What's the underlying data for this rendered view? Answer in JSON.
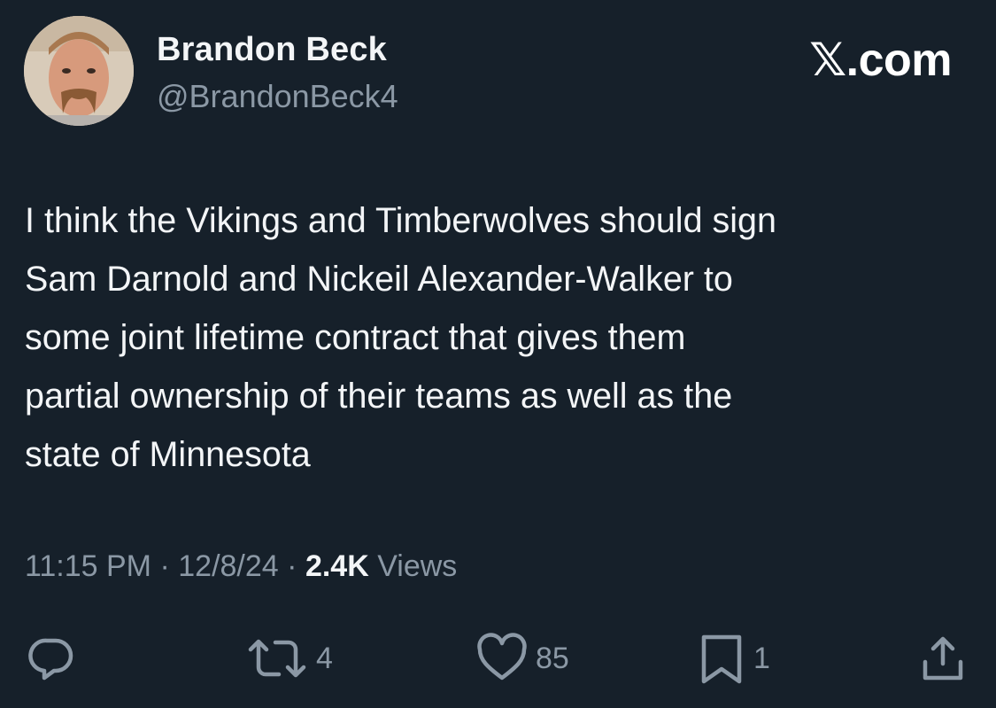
{
  "author": {
    "display_name": "Brandon Beck",
    "handle": "@BrandonBeck4"
  },
  "brand": "𝕏.com",
  "tweet": {
    "text": "I think the Vikings and Timberwolves should sign\nSam Darnold and Nickeil Alexander-Walker to\nsome joint lifetime contract that gives them\npartial ownership of their teams as well as the\nstate of Minnesota"
  },
  "meta": {
    "time": "11:15 PM",
    "separator": "·",
    "date": "12/8/24",
    "views_count": "2.4K",
    "views_label": "Views"
  },
  "actions": {
    "reply": {
      "icon": "reply-icon",
      "count": ""
    },
    "retweet": {
      "icon": "retweet-icon",
      "count": "4"
    },
    "like": {
      "icon": "heart-icon",
      "count": "85"
    },
    "bookmark": {
      "icon": "bookmark-icon",
      "count": "1"
    },
    "share": {
      "icon": "share-icon",
      "count": ""
    }
  },
  "colors": {
    "background": "#16202a",
    "text_primary": "#f3f5f7",
    "text_secondary": "#8b98a5"
  }
}
